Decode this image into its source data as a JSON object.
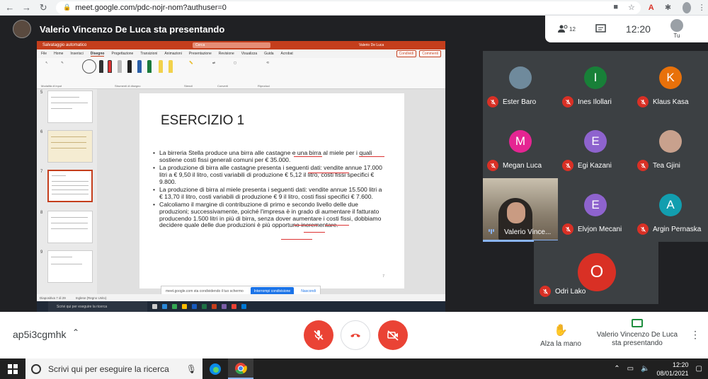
{
  "browser": {
    "url": "meet.google.com/pdc-nojr-nom?authuser=0",
    "back_icon": "←",
    "forward_icon": "→",
    "reload_icon": "↻"
  },
  "meet": {
    "presenter_title": "Valerio Vincenzo De Luca sta presentando",
    "participants_count": "12",
    "clock": "12:20",
    "self_label": "Tu",
    "meeting_code": "ap5i3cgmhk",
    "raise_hand_label": "Alza la mano",
    "presenting_label_line1": "Valerio Vincenzo De Luca",
    "presenting_label_line2": "sta presentando"
  },
  "participants": [
    {
      "name": "Ester Baro",
      "initial": "",
      "color": "#6f8a9c"
    },
    {
      "name": "Ines Ilollari",
      "initial": "I",
      "color": "#188038"
    },
    {
      "name": "Klaus Kasa",
      "initial": "K",
      "color": "#e8710a"
    },
    {
      "name": "Megan Luca",
      "initial": "M",
      "color": "#e52592"
    },
    {
      "name": "Egi Kazani",
      "initial": "E",
      "color": "#8e63ce"
    },
    {
      "name": "Tea Gjini",
      "initial": "",
      "color": "#c8a18d"
    },
    {
      "name": "Valerio Vince...",
      "initial": "",
      "color": ""
    },
    {
      "name": "Elvjon Mecani",
      "initial": "E",
      "color": "#8e63ce"
    },
    {
      "name": "Argin Pernaska",
      "initial": "A",
      "color": "#129eaf"
    },
    {
      "name": "Odri Lako",
      "initial": "O",
      "color": "#d93025"
    }
  ],
  "ppt": {
    "search": "Cerca",
    "user": "Valerio De Luca",
    "menu": [
      "File",
      "Home",
      "Inserisci",
      "Disegno",
      "Progettazione",
      "Transizioni",
      "Animazioni",
      "Presentazione",
      "Revisione",
      "Visualizza",
      "Guida",
      "Acrobat"
    ],
    "share_btn": "Condividi",
    "comments_btn": "Commenti",
    "slide_title": "ESERCIZIO 1",
    "bullets": [
      "La birreria Stella produce una birra alle castagne e una birra al miele per i quali sostiene costi fissi generali comuni per € 35.000.",
      "La produzione di birra alle castagne presenta i seguenti dati: vendite annue 17.000 litri a € 9,50 il litro, costi variabili di produzione € 5,12 il litro, costi fissi specifici € 9.800.",
      "La produzione di birra al miele presenta i seguenti dati: vendite annue 15.500 litri a € 13,70 il litro, costi variabili di produzione € 9 il litro, costi fissi specifici € 7.600.",
      "Calcoliamo il margine di contribuzione di primo e secondo livello delle due produzioni; successivamente, poiché l'impresa è in grado di aumentare il fatturato producendo 1.500 litri in più di birra, senza dover aumentare i costi fissi, dobbiamo decidere quale delle due produzioni è più opportuno incrementare."
    ],
    "page_number": "7",
    "thumb_numbers": [
      "5",
      "6",
      "7",
      "8",
      "9"
    ],
    "status_left": "Diapositiva 7 di 29",
    "status_lang": "Inglese (Regno Unito)",
    "share_notice": "meet.google.com sta condividendo il tuo schermo",
    "stop_sharing": "Interrompi condivisione",
    "hide": "Nascondi",
    "taskbar_search": "Scrivi qui per eseguire la ricerca",
    "taskbar_time": "12:20",
    "taskbar_date": "08/01/2021"
  },
  "windows": {
    "search_placeholder": "Scrivi qui per eseguire la ricerca",
    "time": "12:20",
    "date": "08/01/2021"
  }
}
